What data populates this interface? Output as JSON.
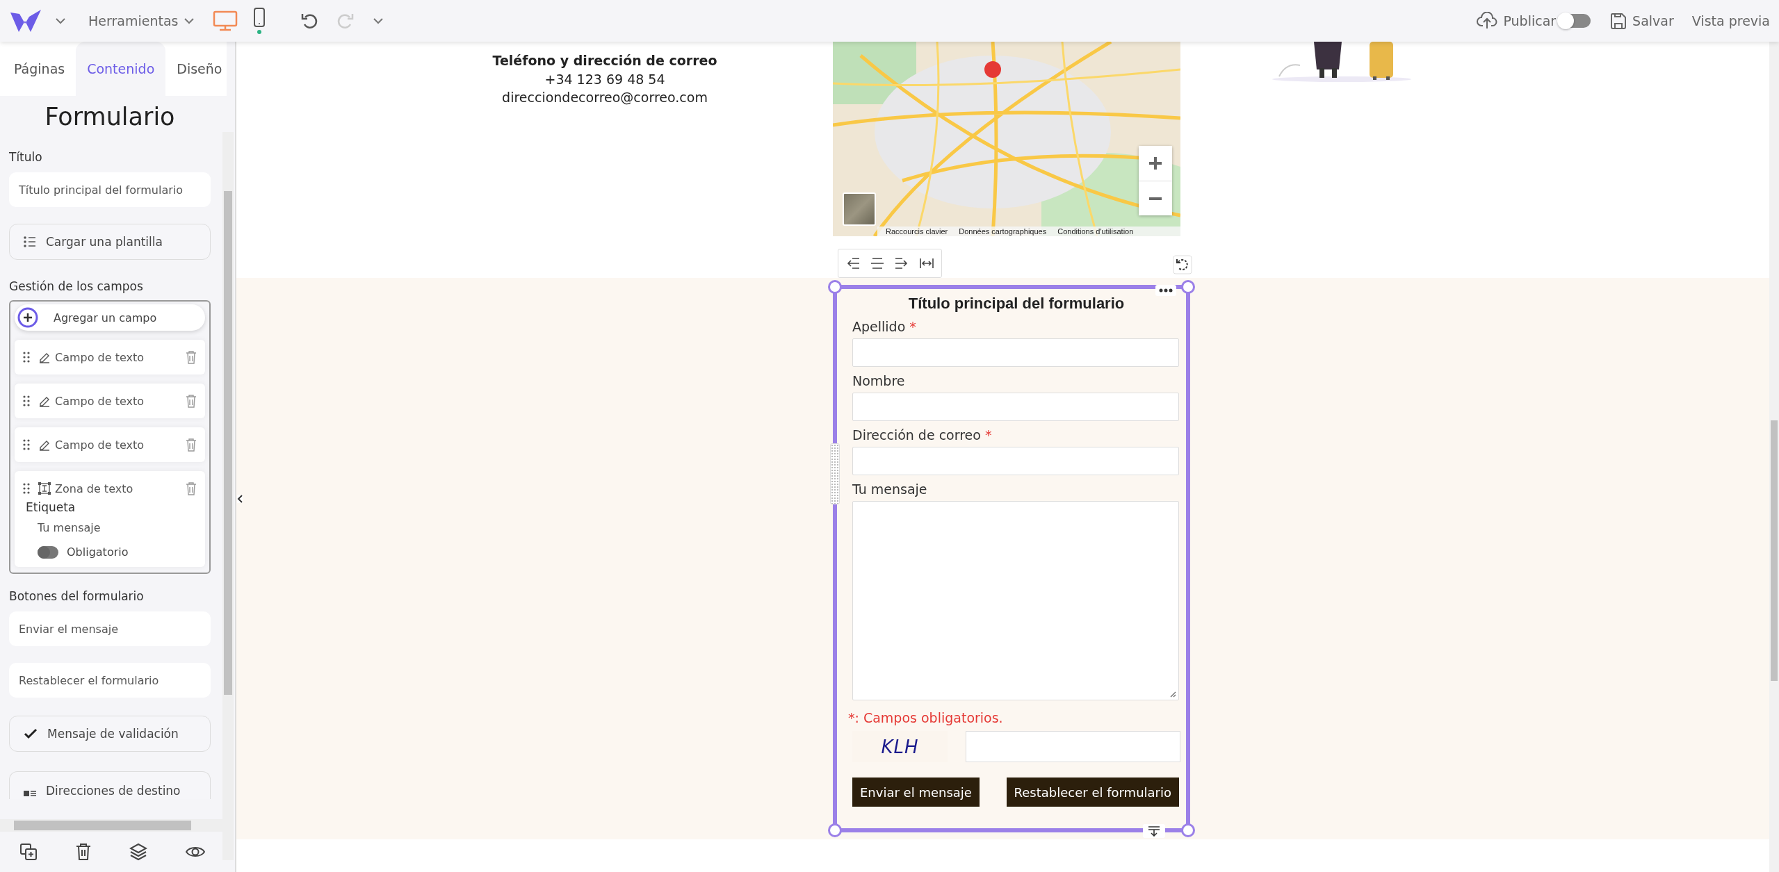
{
  "topbar": {
    "tools_menu": "Herramientas",
    "devices": [
      {
        "kind": "desktop",
        "selected": true
      },
      {
        "kind": "mobile",
        "selected": false
      }
    ],
    "history": [
      {
        "kind": "undo",
        "disabled": false
      },
      {
        "kind": "redo",
        "disabled": true
      }
    ],
    "publish": {
      "label": "Publicar",
      "on": false
    },
    "save": "Salvar",
    "preview": "Vista previa"
  },
  "sidebar": {
    "tabs": [
      {
        "label": "Páginas",
        "selected": false
      },
      {
        "label": "Contenido",
        "selected": true
      },
      {
        "label": "Diseño",
        "selected": false
      }
    ],
    "heading": "Formulario",
    "title_label": "Título",
    "title_value": "Título principal del formulario",
    "template_button": "Cargar una plantilla",
    "fields_label": "Gestión de los campos",
    "add_field": "Agregar un campo",
    "fields": [
      {
        "kind": "text",
        "label": "Campo de texto",
        "expanded": false
      },
      {
        "kind": "text",
        "label": "Campo de texto",
        "expanded": false
      },
      {
        "kind": "text",
        "label": "Campo de texto",
        "expanded": false
      },
      {
        "kind": "textarea",
        "label": "Zona de texto",
        "expanded": true,
        "detail_label": "Etiqueta",
        "detail_value": "Tu mensaje",
        "required": {
          "label": "Obligatorio",
          "on": false
        }
      }
    ],
    "buttons_label": "Botones del formulario",
    "submit_value": "Enviar el mensaje",
    "reset_value": "Restablecer el formulario",
    "validation_button": "Mensaje de validación",
    "recipients_button": "Direcciones de destino"
  },
  "contact": {
    "heading": "Teléfono y dirección de correo",
    "phone": "+34 123 69 48 54",
    "email": "direcciondecorreo@correo.com"
  },
  "map": {
    "attribution": [
      "Raccourcis clavier",
      "Données cartographiques",
      "Conditions d'utilisation"
    ]
  },
  "form": {
    "title": "Título principal del formulario",
    "required_mark": "*",
    "fields": [
      {
        "kind": "input",
        "label": "Apellido",
        "required": true
      },
      {
        "kind": "input",
        "label": "Nombre",
        "required": false
      },
      {
        "kind": "input",
        "label": "Dirección de correo",
        "required": true
      },
      {
        "kind": "textarea",
        "label": "Tu mensaje",
        "required": false
      }
    ],
    "required_note": "*: Campos obligatorios.",
    "captcha": "KLH",
    "buttons": [
      "Enviar el mensaje",
      "Restablecer el formulario"
    ]
  }
}
